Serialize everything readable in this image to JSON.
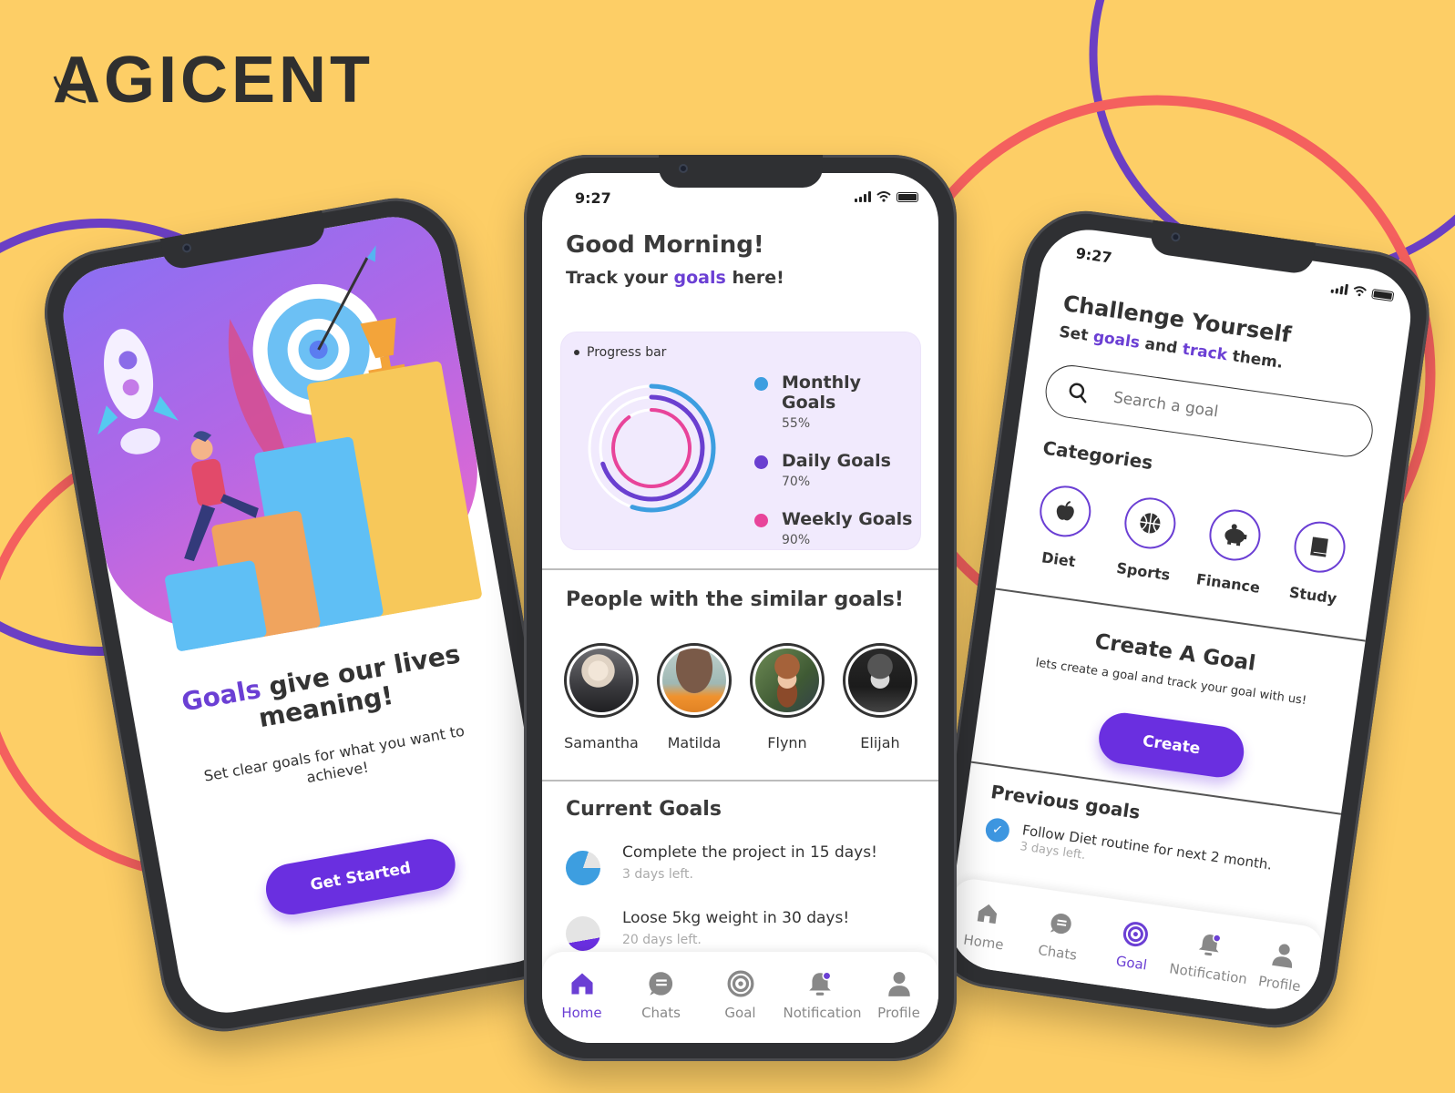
{
  "brand": {
    "logo_text": "AGICENT"
  },
  "colors": {
    "background": "#fdce66",
    "accent_purple": "#6a2fe0",
    "ring_purple": "#6a3fd0",
    "ring_blue": "#3d9ee0",
    "ring_pink": "#e8449a",
    "deco_ring_purple": "#6b3fc4",
    "deco_ring_red": "#f4605e"
  },
  "status_bar": {
    "time": "9:27"
  },
  "onboarding": {
    "title_accent": "Goals",
    "title_rest": " give our lives meaning!",
    "subtitle": "Set clear goals for what you want to achieve!",
    "cta_label": "Get Started"
  },
  "home": {
    "greeting": "Good Morning!",
    "subtitle_prefix": "Track your ",
    "subtitle_accent": "goals",
    "subtitle_suffix": " here!",
    "progress_card": {
      "title": "Progress bar",
      "items": [
        {
          "name": "Monthly Goals",
          "value_label": "55%",
          "value": 0.55,
          "color": "#3d9ee0"
        },
        {
          "name": "Daily Goals",
          "value_label": "70%",
          "value": 0.7,
          "color": "#6a3fd0"
        },
        {
          "name": "Weekly Goals",
          "value_label": "90%",
          "value": 0.9,
          "color": "#e8449a"
        }
      ]
    },
    "people_title": "People with the similar goals!",
    "people": [
      {
        "name": "Samantha"
      },
      {
        "name": "Matilda"
      },
      {
        "name": "Flynn"
      },
      {
        "name": "Elijah"
      }
    ],
    "current_goals_title": "Current Goals",
    "current_goals": [
      {
        "title": "Complete the project in 15 days!",
        "subtitle": "3 days left.",
        "progress": 0.8,
        "color": "#3d9ee0"
      },
      {
        "title": "Loose 5kg weight in 30 days!",
        "subtitle": "20 days left.",
        "progress": 0.33,
        "color": "#6a2fe0"
      }
    ]
  },
  "challenge": {
    "title": "Challenge Yourself",
    "subtitle_parts": [
      "Set ",
      "goals",
      " and ",
      "track",
      " them."
    ],
    "search_placeholder": "Search a goal",
    "categories_title": "Categories",
    "categories": [
      {
        "label": "Diet",
        "icon": "apple-icon"
      },
      {
        "label": "Sports",
        "icon": "basketball-icon"
      },
      {
        "label": "Finance",
        "icon": "piggy-bank-icon"
      },
      {
        "label": "Study",
        "icon": "book-icon"
      }
    ],
    "create_title": "Create A Goal",
    "create_subtitle": "lets create a goal and track your goal with us!",
    "create_button": "Create",
    "previous_title": "Previous goals",
    "previous_goals": [
      {
        "title": "Follow Diet routine for next 2 month.",
        "subtitle": "3 days left."
      }
    ]
  },
  "tabbar": {
    "tabs": [
      {
        "label": "Home",
        "icon": "home-icon"
      },
      {
        "label": "Chats",
        "icon": "chat-icon"
      },
      {
        "label": "Goal",
        "icon": "target-icon"
      },
      {
        "label": "Notification",
        "icon": "bell-icon"
      },
      {
        "label": "Profile",
        "icon": "user-icon"
      }
    ],
    "home_active": "Home",
    "challenge_active": "Goal"
  }
}
